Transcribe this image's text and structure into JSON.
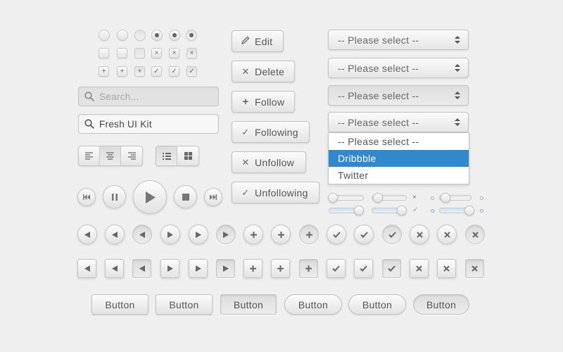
{
  "colors": {
    "background": "#efefef",
    "selection": "#2f89cc"
  },
  "radios": [
    "off",
    "off",
    "pressed",
    "checked",
    "checked",
    "checked-pressed"
  ],
  "checkbox_rows": [
    {
      "icons": [
        "",
        "",
        "",
        "×",
        "×",
        "×"
      ]
    },
    {
      "icons": [
        "+",
        "+",
        "+",
        "✓",
        "✓",
        "✓"
      ]
    }
  ],
  "search": {
    "placeholder": "Search...",
    "filled_value": "Fresh UI Kit"
  },
  "text_align": [
    "align-left-icon",
    "align-center-icon",
    "align-right-icon"
  ],
  "view_toggle": [
    "list-view-icon",
    "grid-view-icon"
  ],
  "media": [
    "previous-icon",
    "pause-icon",
    "play-icon",
    "stop-icon",
    "next-icon"
  ],
  "actions": [
    {
      "label": "Edit",
      "icon": "pencil-icon"
    },
    {
      "label": "Delete",
      "icon": "x-icon"
    },
    {
      "label": "Follow",
      "icon": "plus-icon"
    },
    {
      "label": "Following",
      "icon": "check-icon"
    },
    {
      "label": "Unfollow",
      "icon": "x-icon"
    },
    {
      "label": "Unfollowing",
      "icon": "check-icon"
    }
  ],
  "selects": {
    "value": "-- Please select --",
    "options": [
      "-- Please select --",
      "Dribbble",
      "Twitter"
    ],
    "highlighted_option": "Dribbble"
  },
  "sliders": {
    "left_column": [
      0.0,
      0.85
    ],
    "middle_column": [
      0.15,
      0.85
    ],
    "right_column": [
      0.15,
      0.85
    ],
    "middle_marks": [
      "×",
      "✓"
    ]
  },
  "icon_button_rows": [
    "left-arrow-icon",
    "play-arrow-icon",
    "plus-icon",
    "check-icon",
    "x-icon"
  ],
  "bottom_buttons": {
    "label": "Button"
  }
}
